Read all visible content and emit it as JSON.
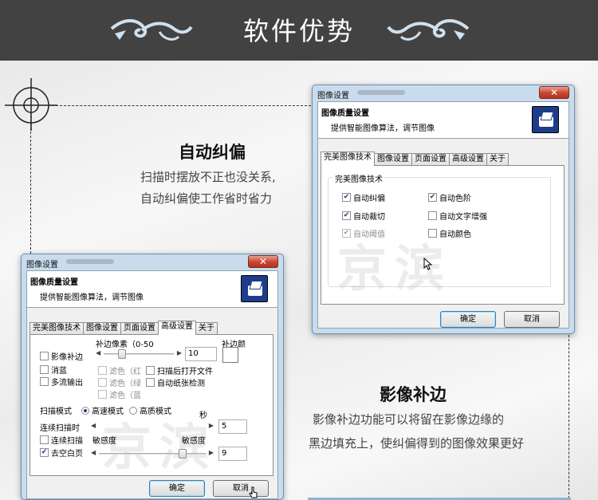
{
  "banner": {
    "title": "软件优势"
  },
  "feature1": {
    "title": "自动纠偏",
    "desc_line1": "扫描时摆放不正也没关系,",
    "desc_line2": "自动纠偏使工作省时省力"
  },
  "feature2": {
    "title": "影像补边",
    "desc_line1": "影像补边功能可以将留在影像边缘的",
    "desc_line2": "黑边填充上，使纠偏得到的图像效果更好"
  },
  "dialog1": {
    "window_title": "图像设置",
    "header_title": "图像质量设置",
    "header_subtitle": "提供智能图像算法，调节图像",
    "tabs": [
      "完美图像技术",
      "图像设置",
      "页面设置",
      "高级设置",
      "关于"
    ],
    "active_tab": "完美图像技术",
    "group_label": "完美图像技术",
    "options": [
      {
        "label": "自动纠偏",
        "checked": true,
        "enabled": true
      },
      {
        "label": "自动色阶",
        "checked": true,
        "enabled": true
      },
      {
        "label": "自动裁切",
        "checked": true,
        "enabled": true
      },
      {
        "label": "自动文字增强",
        "checked": false,
        "enabled": true
      },
      {
        "label": "自动阈值",
        "checked": true,
        "enabled": false
      },
      {
        "label": "自动颜色",
        "checked": false,
        "enabled": true
      }
    ],
    "ok_label": "确定",
    "cancel_label": "取消",
    "watermark": "京滨"
  },
  "dialog2": {
    "window_title": "图像设置",
    "header_title": "图像质量设置",
    "header_subtitle": "提供智能图像算法，调节图像",
    "tabs": [
      "完美图像技术",
      "图像设置",
      "页面设置",
      "高级设置",
      "关于"
    ],
    "active_tab": "高级设置",
    "fill_pixels_label": "补边像素（0-50",
    "fill_color_label": "补边颜",
    "fill_pixels_value": "10",
    "image_fill": {
      "label": "影像补边",
      "checked": false
    },
    "remove_blue": {
      "label": "消蓝",
      "checked": false
    },
    "multi_stream": {
      "label": "多流输出",
      "checked": false
    },
    "filter_red": {
      "label": "滤色（红",
      "checked": false
    },
    "filter_green": {
      "label": "滤色（绿",
      "checked": false
    },
    "filter_blue": {
      "label": "滤色（蓝",
      "checked": false
    },
    "open_after_scan": {
      "label": "扫描后打开文件",
      "checked": false
    },
    "auto_paper_detect": {
      "label": "自动纸张检测",
      "checked": false
    },
    "scan_mode_label": "扫描模式",
    "scan_mode_fast": "高速模式",
    "scan_mode_hq": "高质模式",
    "scan_mode_selected": "高速模式",
    "continuous_label": "连续扫描时",
    "seconds_label": "秒",
    "continuous_value": "5",
    "continuous_scan": {
      "label": "连续扫描",
      "checked": false
    },
    "sensitivity_label_1": "敏感度",
    "sensitivity_label_2": "敏感度",
    "remove_blank": {
      "label": "去空白页",
      "checked": true
    },
    "sensitivity_value": "9",
    "ok_label": "确定",
    "cancel_label": "取消",
    "watermark": "京滨"
  },
  "colors": {
    "banner_bg": "#424242",
    "window_frame": "#c9dced",
    "close_button": "#c6452f",
    "logo": "#1d3c8a"
  }
}
